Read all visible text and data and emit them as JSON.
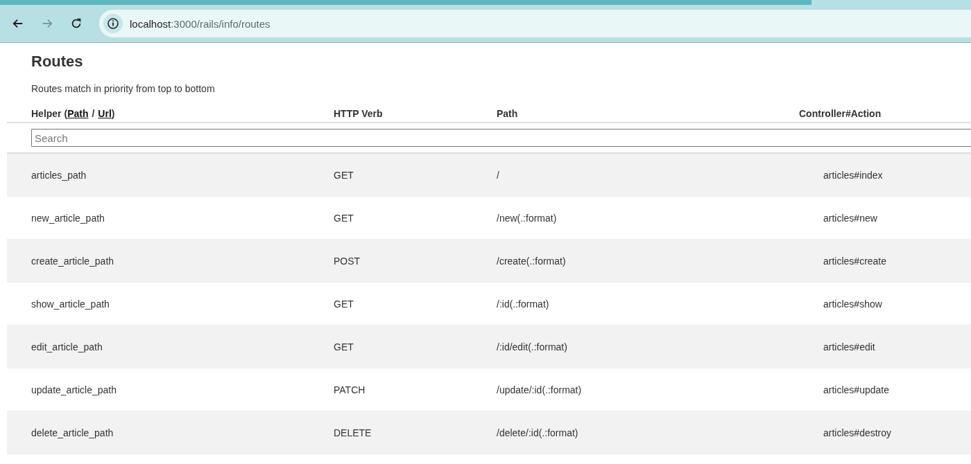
{
  "browser": {
    "url_host": "localhost",
    "url_path": ":3000/rails/info/routes",
    "back_enabled": true,
    "forward_enabled": false
  },
  "page": {
    "title": "Routes",
    "subtitle": "Routes match in priority from top to bottom"
  },
  "table": {
    "header": {
      "helper_prefix": "Helper (",
      "path_link": "Path",
      "separator": "/",
      "url_link": "Url",
      "suffix": ")",
      "verb": "HTTP Verb",
      "path": "Path",
      "action": "Controller#Action"
    },
    "search": {
      "placeholder": "Search"
    },
    "rows": [
      {
        "helper": "articles_path",
        "verb": "GET",
        "path": "/",
        "action": "articles#index"
      },
      {
        "helper": "new_article_path",
        "verb": "GET",
        "path": "/new(.:format)",
        "action": "articles#new"
      },
      {
        "helper": "create_article_path",
        "verb": "POST",
        "path": "/create(.:format)",
        "action": "articles#create"
      },
      {
        "helper": "show_article_path",
        "verb": "GET",
        "path": "/:id(.:format)",
        "action": "articles#show"
      },
      {
        "helper": "edit_article_path",
        "verb": "GET",
        "path": "/:id/edit(.:format)",
        "action": "articles#edit"
      },
      {
        "helper": "update_article_path",
        "verb": "PATCH",
        "path": "/update/:id(.:format)",
        "action": "articles#update"
      },
      {
        "helper": "delete_article_path",
        "verb": "DELETE",
        "path": "/delete/:id(.:format)",
        "action": "articles#destroy"
      }
    ]
  }
}
